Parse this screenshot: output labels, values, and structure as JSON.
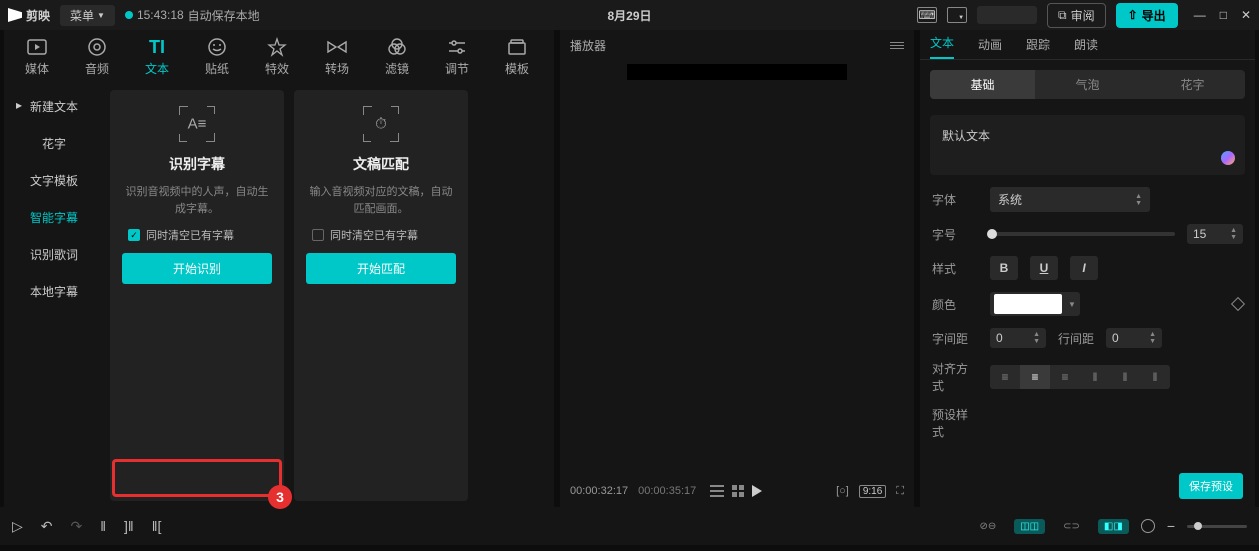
{
  "topbar": {
    "app_name": "剪映",
    "menu_label": "菜单",
    "save_time": "15:43:18",
    "save_text": "自动保存本地",
    "date": "8月29日",
    "review_label": "审阅",
    "export_label": "导出"
  },
  "tool_tabs": [
    {
      "label": "媒体"
    },
    {
      "label": "音频"
    },
    {
      "label": "文本"
    },
    {
      "label": "贴纸"
    },
    {
      "label": "特效"
    },
    {
      "label": "转场"
    },
    {
      "label": "滤镜"
    },
    {
      "label": "调节"
    },
    {
      "label": "模板"
    }
  ],
  "left_nav": [
    {
      "label": "新建文本",
      "arrow": true
    },
    {
      "label": "花字"
    },
    {
      "label": "文字模板"
    },
    {
      "label": "智能字幕",
      "active": true
    },
    {
      "label": "识别歌词"
    },
    {
      "label": "本地字幕"
    }
  ],
  "cards": {
    "subtitle": {
      "title": "识别字幕",
      "desc": "识别音视频中的人声，自动生成字幕。",
      "checkbox": "同时清空已有字幕",
      "button": "开始识别",
      "badge": "3"
    },
    "script": {
      "title": "文稿匹配",
      "desc": "输入音视频对应的文稿，自动匹配画面。",
      "checkbox": "同时清空已有字幕",
      "button": "开始匹配"
    }
  },
  "player": {
    "header": "播放器",
    "current": "00:00:32:17",
    "total": "00:00:35:17",
    "ratio": "9:16"
  },
  "right": {
    "tabs": [
      "文本",
      "动画",
      "跟踪",
      "朗读"
    ],
    "sub_tabs": [
      "基础",
      "气泡",
      "花字"
    ],
    "default_text": "默认文本",
    "font_label": "字体",
    "font_value": "系统",
    "size_label": "字号",
    "size_value": "15",
    "style_label": "样式",
    "style_b": "B",
    "style_u": "U",
    "style_i": "I",
    "color_label": "颜色",
    "char_spacing_label": "字间距",
    "char_spacing_value": "0",
    "line_spacing_label": "行间距",
    "line_spacing_value": "0",
    "align_label": "对齐方式",
    "preset_label": "预设样式",
    "save_preset": "保存预设"
  }
}
